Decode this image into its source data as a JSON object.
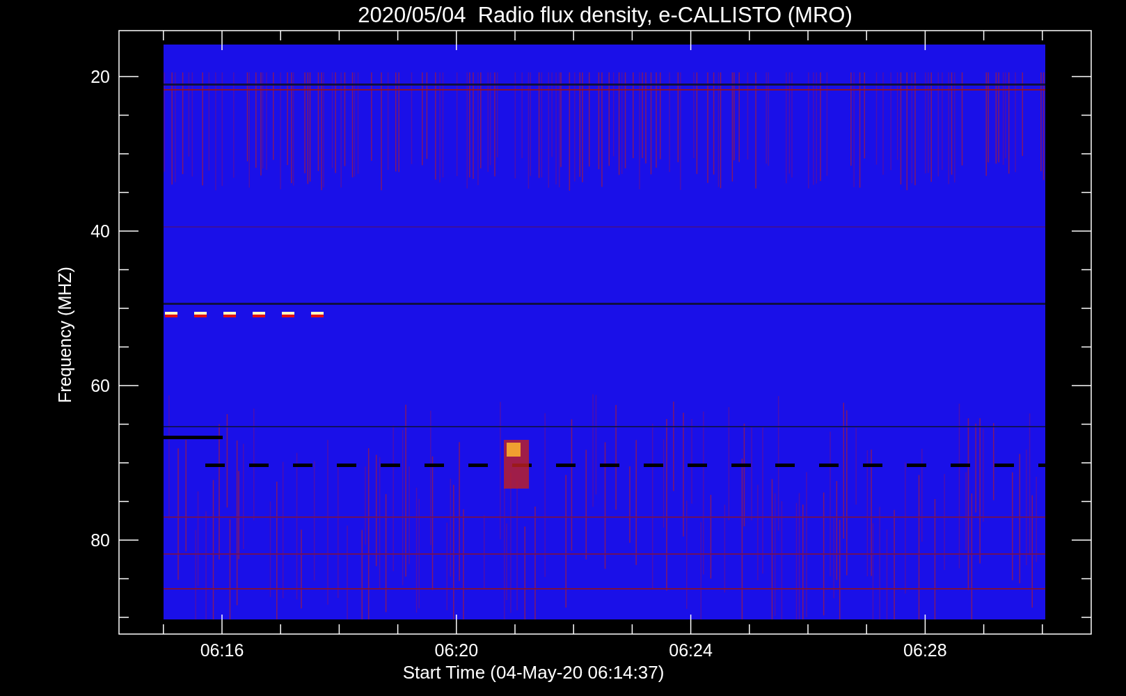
{
  "title": "2020/05/04  Radio flux density, e-CALLISTO (MRO)",
  "y_axis": {
    "title": "Frequency (MHZ)",
    "tick_labels": [
      "20",
      "40",
      "60",
      "80"
    ]
  },
  "x_axis": {
    "title": "Start Time (04-May-20 06:14:37)",
    "tick_labels": [
      "06:16",
      "06:20",
      "06:24",
      "06:28"
    ]
  }
}
